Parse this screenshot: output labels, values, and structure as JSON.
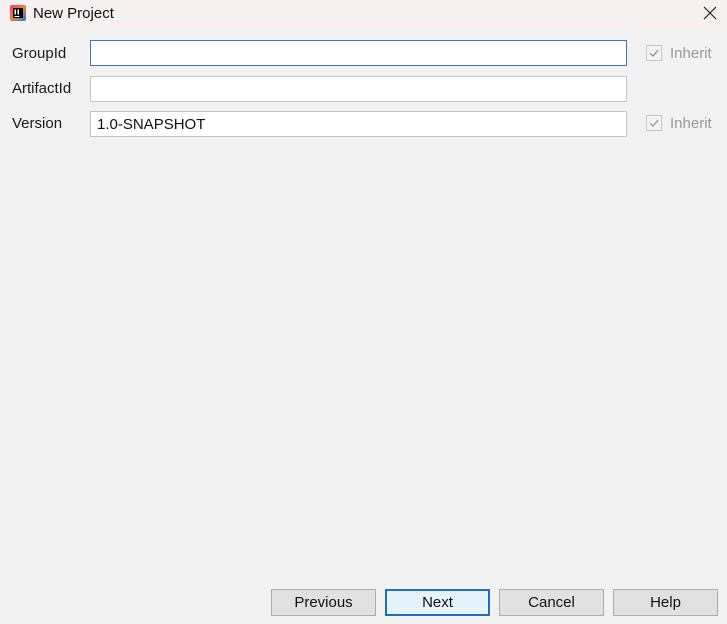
{
  "window": {
    "title": "New Project",
    "app_icon": "intellij-idea-icon"
  },
  "form": {
    "groupId": {
      "label": "GroupId",
      "value": "",
      "inherit_label": "Inherit",
      "inherit_checked": true
    },
    "artifactId": {
      "label": "ArtifactId",
      "value": ""
    },
    "version": {
      "label": "Version",
      "value": "1.0-SNAPSHOT",
      "inherit_label": "Inherit",
      "inherit_checked": true
    }
  },
  "buttons": {
    "previous": "Previous",
    "next": "Next",
    "cancel": "Cancel",
    "help": "Help"
  },
  "colors": {
    "focus_border": "#3b78c4",
    "default_button_border": "#1a6fc4",
    "disabled_text": "#9a9a9a"
  }
}
